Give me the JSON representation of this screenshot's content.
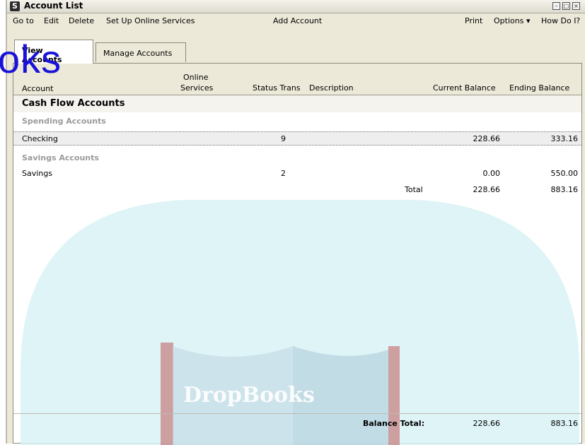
{
  "window": {
    "title": "Account List",
    "icon_label": "S",
    "controls": [
      "minimize-icon",
      "restore-icon",
      "close-icon"
    ]
  },
  "menu": {
    "goto": "Go to",
    "edit": "Edit",
    "delete": "Delete",
    "setup": "Set Up Online Services",
    "add": "Add Account",
    "print": "Print",
    "options": "Options ▾",
    "howdoi": "How Do I?"
  },
  "tabs": {
    "view": "View Accounts",
    "manage": "Manage Accounts"
  },
  "columns": {
    "account": "Account",
    "online1": "Online",
    "online2": "Services",
    "status_trans": "Status Trans",
    "description": "Description",
    "current": "Current Balance",
    "ending": "Ending Balance"
  },
  "groups": {
    "cashflow": "Cash Flow Accounts",
    "spending": "Spending Accounts",
    "savings_header": "Savings Accounts"
  },
  "rows": [
    {
      "name": "Checking",
      "trans": "9",
      "current": "228.66",
      "ending": "333.16"
    },
    {
      "name": "Savings",
      "trans": "2",
      "current": "0.00",
      "ending": "550.00"
    }
  ],
  "total": {
    "label": "Total",
    "current": "228.66",
    "ending": "883.16"
  },
  "balance_total": {
    "label": "Balance Total:",
    "current": "228.66",
    "ending": "883.16"
  },
  "watermark": {
    "text": "oks",
    "logo_text": "DropBooks",
    "accent": "#1a12d8",
    "teal": "#d6f2f6"
  }
}
